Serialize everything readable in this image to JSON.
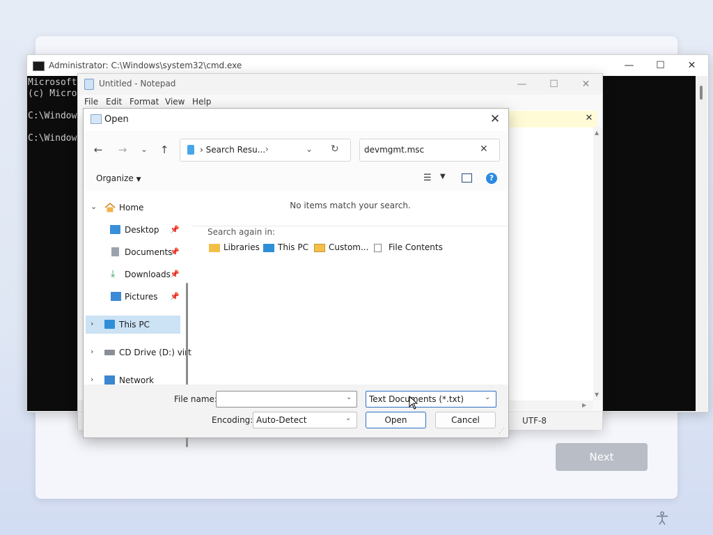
{
  "setup": {
    "next_label": "Next"
  },
  "cmd": {
    "title": "Administrator: C:\\Windows\\system32\\cmd.exe",
    "lines": [
      "Microsoft",
      "(c) Micro",
      "",
      "C:\\Window",
      "",
      "C:\\Window"
    ]
  },
  "notepad": {
    "title": "Untitled - Notepad",
    "menu": [
      "File",
      "Edit",
      "Format",
      "View",
      "Help"
    ],
    "status_encoding": "UTF-8"
  },
  "dialog": {
    "title": "Open",
    "address": "Search Resu...",
    "search_value": "devmgmt.msc",
    "organize_label": "Organize",
    "nav_items": [
      {
        "label": "Home",
        "icon": "home-icon"
      },
      {
        "label": "Desktop",
        "icon": "desktop-icon"
      },
      {
        "label": "Documents",
        "icon": "documents-icon"
      },
      {
        "label": "Downloads",
        "icon": "downloads-icon"
      },
      {
        "label": "Pictures",
        "icon": "pictures-icon"
      },
      {
        "label": "This PC",
        "icon": "this-pc-icon"
      },
      {
        "label": "CD Drive (D:) virt",
        "icon": "cd-drive-icon"
      },
      {
        "label": "Network",
        "icon": "network-icon"
      }
    ],
    "no_items_text": "No items match your search.",
    "search_again_label": "Search again in:",
    "search_again_items": [
      "Libraries",
      "This PC",
      "Custom...",
      "File Contents"
    ],
    "file_name_label": "File name:",
    "file_name_value": "",
    "file_type_value": "Text Documents (*.txt)",
    "encoding_label": "Encoding:",
    "encoding_value": "Auto-Detect",
    "open_label": "Open",
    "cancel_label": "Cancel"
  },
  "colors": {
    "accent": "#2b6fc4",
    "help": "#2a8ae3",
    "selected_nav": "#cce2f5",
    "console_bg": "#0c0c0c"
  }
}
